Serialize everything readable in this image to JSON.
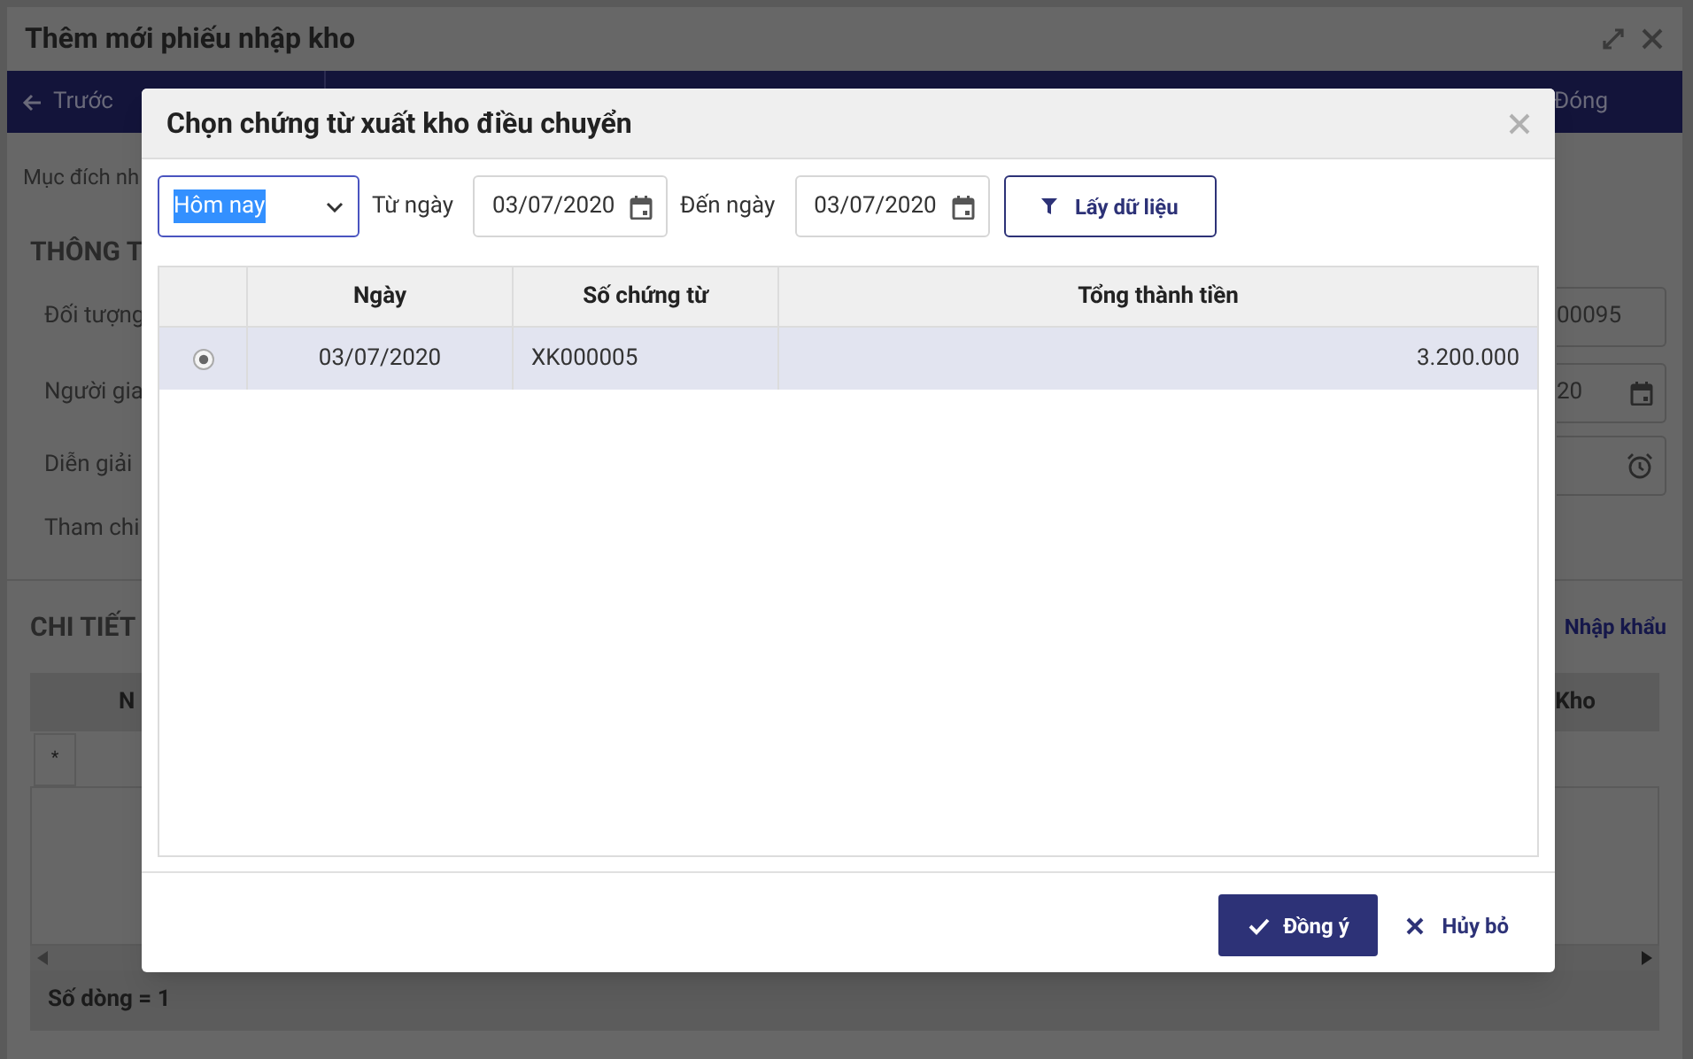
{
  "window": {
    "title": "Thêm mới phiếu nhập kho"
  },
  "toolbar": {
    "back_button": "Trước",
    "close_button": "Đóng"
  },
  "form": {
    "purpose_label": "Mục đích nh",
    "section_title": "THÔNG T",
    "fields": [
      {
        "label": "Đối tượng",
        "value": "00095",
        "kind": "text"
      },
      {
        "label": "Người gia",
        "value": "20",
        "kind": "date"
      },
      {
        "label": "Diễn giải",
        "kind": "time"
      },
      {
        "label": "Tham chi",
        "kind": "none"
      }
    ]
  },
  "details": {
    "title": "CHI TIẾT",
    "import_link": "Nhập khẩu",
    "columns": [
      "N",
      "Kho"
    ],
    "new_row_marker": "*",
    "footer": "Số dòng = 1"
  },
  "dialog": {
    "title": "Chọn chứng từ xuất kho điều chuyển",
    "period": "Hôm nay",
    "from_label": "Từ ngày",
    "from_date": "03/07/2020",
    "to_label": "Đến ngày",
    "to_date": "03/07/2020",
    "fetch_button": "Lấy dữ liệu",
    "columns": [
      "Ngày",
      "Số chứng từ",
      "Tổng thành tiền"
    ],
    "rows": [
      {
        "selected": true,
        "date": "03/07/2020",
        "number": "XK000005",
        "total": "3.200.000"
      }
    ],
    "ok_button": "Đồng ý",
    "cancel_button": "Hủy bỏ"
  }
}
